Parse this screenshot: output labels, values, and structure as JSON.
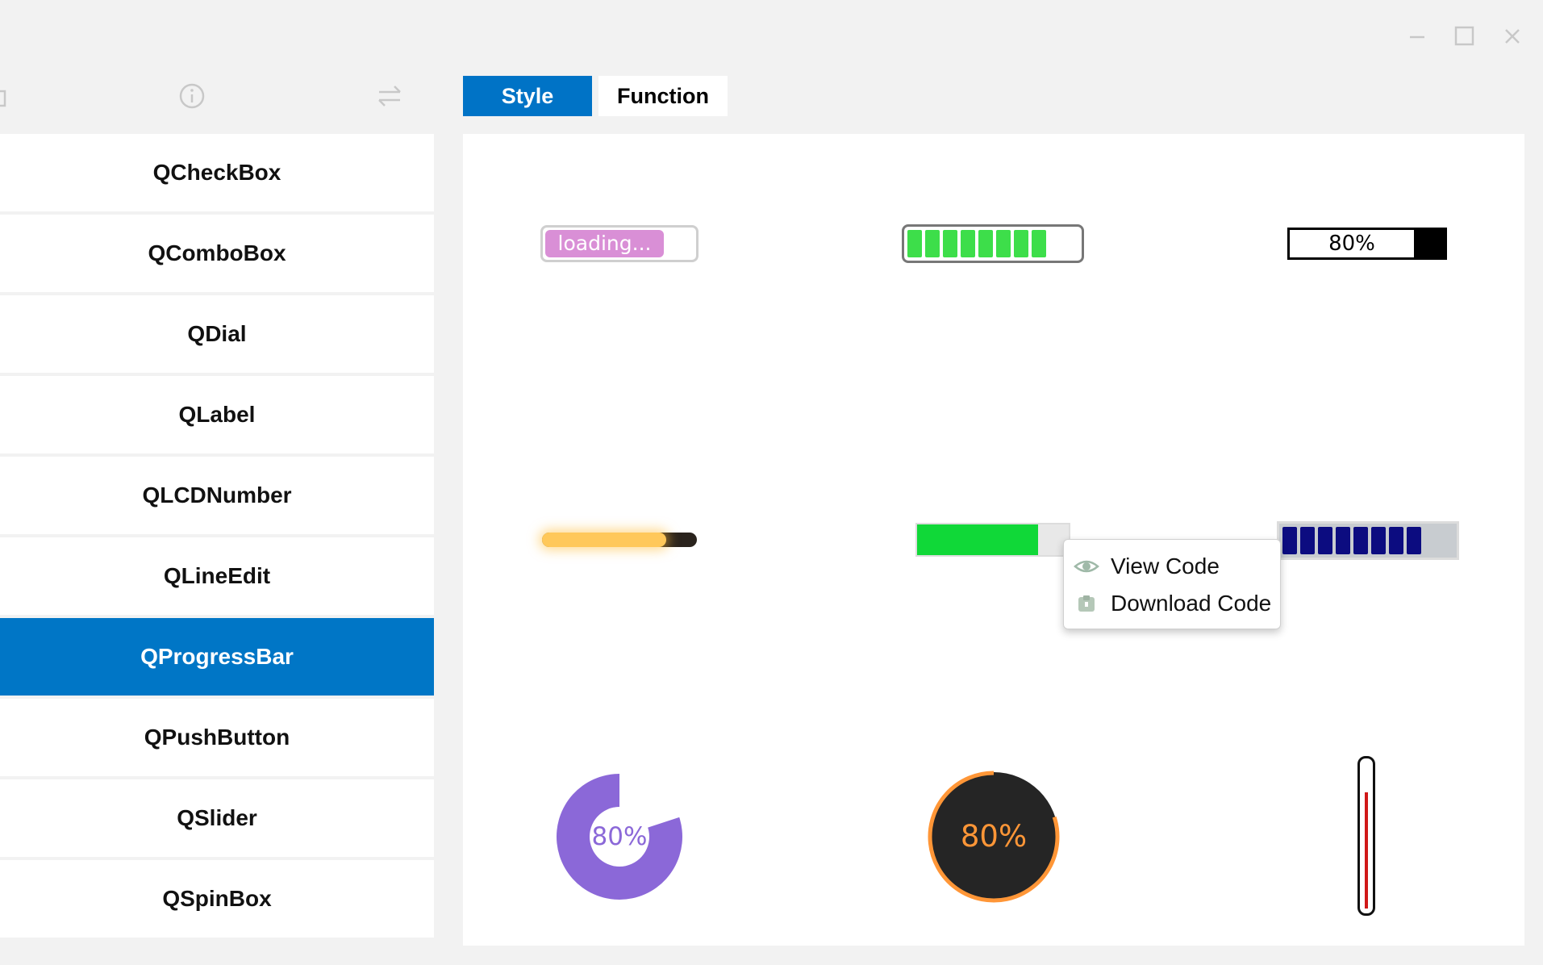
{
  "tabs": [
    {
      "label": "Style",
      "active": true
    },
    {
      "label": "Function",
      "active": false
    }
  ],
  "sidebar": {
    "items": [
      {
        "label": "QCheckBox"
      },
      {
        "label": "QComboBox"
      },
      {
        "label": "QDial"
      },
      {
        "label": "QLabel"
      },
      {
        "label": "QLCDNumber"
      },
      {
        "label": "QLineEdit"
      },
      {
        "label": "QProgressBar",
        "selected": true
      },
      {
        "label": "QPushButton"
      },
      {
        "label": "QSlider"
      },
      {
        "label": "QSpinBox"
      }
    ]
  },
  "progress": {
    "loading_text": "loading...",
    "loading_value": 0.8,
    "green_segments_value": 0.8,
    "black_text": "80%",
    "black_value": 0.8,
    "yellow_value": 0.8,
    "green_flat_value": 0.8,
    "navy_segments_value": 0.8,
    "ring_purple_text": "80%",
    "ring_purple_value": 0.8,
    "ring_orange_text": "80%",
    "ring_orange_value": 0.8,
    "thermometer_value": 0.8
  },
  "context_menu": {
    "items": [
      {
        "label": "View Code",
        "icon": "eye-icon"
      },
      {
        "label": "Download Code",
        "icon": "download-icon"
      }
    ]
  },
  "colors": {
    "accent": "#0073c6",
    "loading_fill": "#d98fd6",
    "green_segment": "#3dde4a",
    "yellow": "#ffc85a",
    "green_flat": "#10d838",
    "navy": "#0c0c80",
    "purple": "#8b68d8",
    "orange": "#ff9637",
    "dark": "#252525",
    "thermo_red": "#d01818"
  }
}
